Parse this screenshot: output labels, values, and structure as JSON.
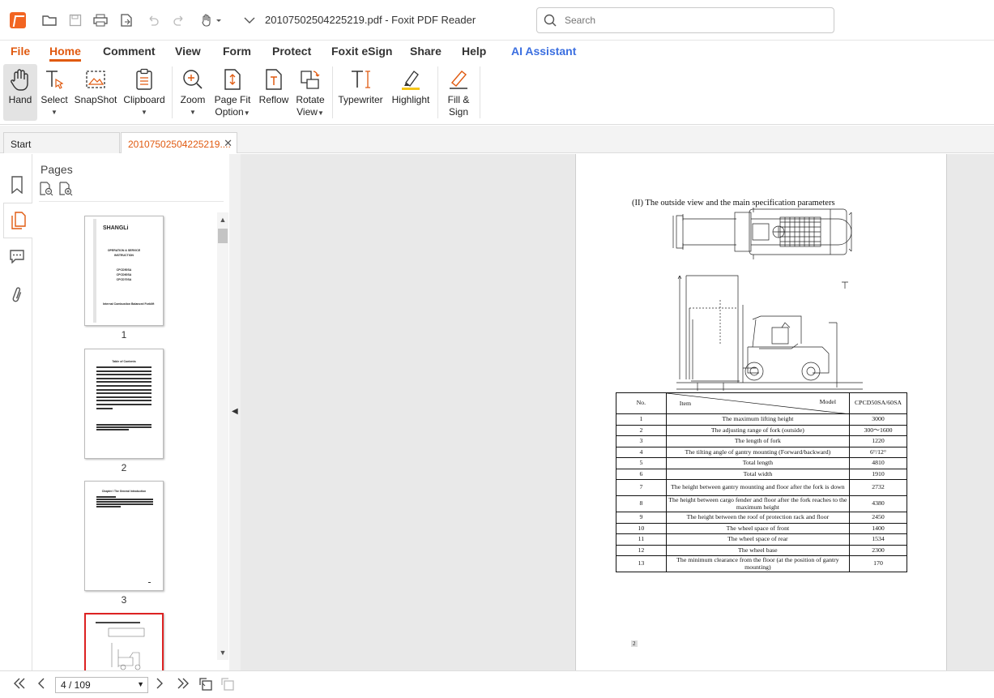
{
  "window": {
    "title": "20107502504225219.pdf - Foxit PDF Reader"
  },
  "search": {
    "placeholder": "Search"
  },
  "menu": {
    "file": "File",
    "home": "Home",
    "comment": "Comment",
    "view": "View",
    "form": "Form",
    "protect": "Protect",
    "esign": "Foxit eSign",
    "share": "Share",
    "help": "Help",
    "ai": "AI Assistant"
  },
  "ribbon": {
    "hand": "Hand",
    "select": "Select",
    "snapshot": "SnapShot",
    "clipboard": "Clipboard",
    "zoom": "Zoom",
    "pagefit_1": "Page Fit",
    "pagefit_2": "Option",
    "reflow": "Reflow",
    "rotate_1": "Rotate",
    "rotate_2": "View",
    "typewriter": "Typewriter",
    "highlight": "Highlight",
    "fillsign_1": "Fill &",
    "fillsign_2": "Sign"
  },
  "tabs": {
    "start": "Start",
    "document": "20107502504225219...."
  },
  "sidebar": {
    "pages_title": "Pages",
    "thumbnails": [
      "1",
      "2",
      "3"
    ],
    "thumb1": {
      "brand": "SHANGLi",
      "line1": "OPERATION & SERVICE",
      "line2": "INSTRUCTION",
      "line3": "CPCD50SA",
      "line4": "CPCD60SA",
      "line5": "CPCD70SA",
      "footer": "Internal Combustion Balanced Forklift"
    },
    "thumb2": {
      "heading": "Table of Contents"
    },
    "thumb3": {
      "heading": "Chapter I  The General Introduction"
    }
  },
  "document": {
    "heading": "(II) The outside view and the main specification parameters",
    "table": {
      "col_no": "No.",
      "col_item": "Item",
      "col_model": "Model",
      "col_value": "CPCD50SA/60SA",
      "rows": [
        {
          "no": "1",
          "item": "The maximum lifting height",
          "value": "3000"
        },
        {
          "no": "2",
          "item": "The adjusting range of fork (outside)",
          "value": "300～1600"
        },
        {
          "no": "3",
          "item": "The length of fork",
          "value": "1220"
        },
        {
          "no": "4",
          "item": "The tilting angle of gantry mounting (Forward/backward)",
          "value": "6°/12°"
        },
        {
          "no": "5",
          "item": "Total length",
          "value": "4810"
        },
        {
          "no": "6",
          "item": "Total width",
          "value": "1910"
        },
        {
          "no": "7",
          "item": "The height between gantry mounting and floor after the fork is down",
          "value": "2732"
        },
        {
          "no": "8",
          "item": "The height between cargo fender and floor after the fork reaches to the maximum height",
          "value": "4380"
        },
        {
          "no": "9",
          "item": "The height between the roof of protection rack and floor",
          "value": "2450"
        },
        {
          "no": "10",
          "item": "The wheel space of front",
          "value": "1400"
        },
        {
          "no": "11",
          "item": "The wheel space of rear",
          "value": "1534"
        },
        {
          "no": "12",
          "item": "The wheel base",
          "value": "2300"
        },
        {
          "no": "13",
          "item": "The minimum clearance from the floor (at the position of gantry mounting)",
          "value": "170"
        }
      ]
    },
    "page_number": "2"
  },
  "status": {
    "page_value": "4 / 109"
  },
  "colors": {
    "accent": "#e05a10",
    "ai": "#3b6fe0",
    "current_thumb": "#dd2222"
  }
}
